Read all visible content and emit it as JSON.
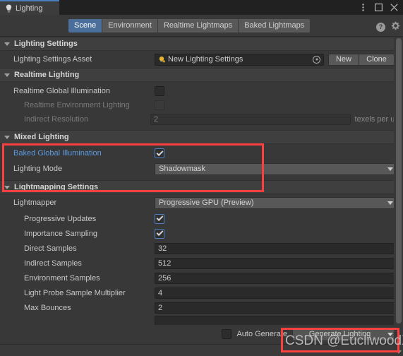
{
  "window": {
    "tab_label": "Lighting",
    "icon": "lightbulb-icon",
    "menu_icon": "kebab-menu-icon",
    "maximize_icon": "maximize-icon",
    "close_icon": "close-icon"
  },
  "toolbar": {
    "tabs": [
      {
        "label": "Scene",
        "active": true
      },
      {
        "label": "Environment",
        "active": false
      },
      {
        "label": "Realtime Lightmaps",
        "active": false
      },
      {
        "label": "Baked Lightmaps",
        "active": false
      }
    ],
    "help_icon": "help-icon",
    "help_glyph": "?",
    "settings_icon": "gear-icon"
  },
  "sections": {
    "lighting_settings": {
      "title": "Lighting Settings",
      "asset_label": "Lighting Settings Asset",
      "asset_value": "New Lighting Settings",
      "new_button": "New",
      "clone_button": "Clone"
    },
    "realtime_lighting": {
      "title": "Realtime Lighting",
      "realtime_gi_label": "Realtime Global Illumination",
      "realtime_gi_checked": false,
      "realtime_env_label": "Realtime Environment Lighting",
      "realtime_env_checked": false,
      "indirect_res_label": "Indirect Resolution",
      "indirect_res_value": "2",
      "indirect_res_unit": "texels per unit"
    },
    "mixed_lighting": {
      "title": "Mixed Lighting",
      "baked_gi_label": "Baked Global Illumination",
      "baked_gi_checked": true,
      "lighting_mode_label": "Lighting Mode",
      "lighting_mode_value": "Shadowmask"
    },
    "lightmapping_settings": {
      "title": "Lightmapping Settings",
      "lightmapper_label": "Lightmapper",
      "lightmapper_value": "Progressive GPU (Preview)",
      "rows": [
        {
          "label": "Progressive Updates",
          "type": "checkbox",
          "checked": true
        },
        {
          "label": "Importance Sampling",
          "type": "checkbox",
          "checked": true
        },
        {
          "label": "Direct Samples",
          "type": "number",
          "value": "32"
        },
        {
          "label": "Indirect Samples",
          "type": "number",
          "value": "512"
        },
        {
          "label": "Environment Samples",
          "type": "number",
          "value": "256"
        },
        {
          "label": "Light Probe Sample Multiplier",
          "type": "number",
          "value": "4"
        },
        {
          "label": "Max Bounces",
          "type": "number",
          "value": "2"
        }
      ]
    }
  },
  "footer": {
    "auto_generate_label": "Auto Generate",
    "auto_generate_checked": false,
    "generate_button": "Generate Lighting",
    "generate_dropdown_icon": "chevron-down-icon"
  },
  "annotations": {
    "watermark": "CSDN @EucliwoodXT",
    "highlight_color": "#fc4040"
  }
}
